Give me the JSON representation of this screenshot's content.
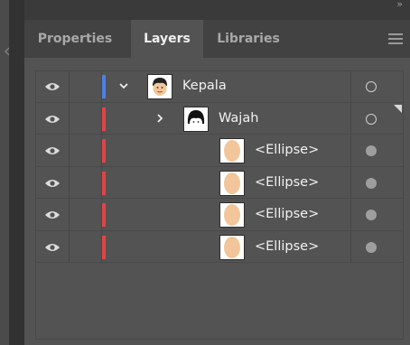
{
  "tabs": [
    {
      "label": "Properties",
      "active": false
    },
    {
      "label": "Layers",
      "active": true
    },
    {
      "label": "Libraries",
      "active": false
    }
  ],
  "top_bar": {
    "collapse_glyph": "»"
  },
  "colors": {
    "parent_layer": "#4f7fe5",
    "sublayer": "#e04545",
    "panel_bg": "#535353",
    "tab_bar_bg": "#424242"
  },
  "layers": [
    {
      "name": "Kepala",
      "expanded": true,
      "thumb": "face-icon"
    },
    {
      "name": "Wajah",
      "expanded": false,
      "thumb": "face-hair-icon"
    },
    {
      "name": "<Ellipse>",
      "thumb": "ellipse-icon"
    },
    {
      "name": "<Ellipse>",
      "thumb": "ellipse-icon"
    },
    {
      "name": "<Ellipse>",
      "thumb": "ellipse-icon"
    },
    {
      "name": "<Ellipse>",
      "thumb": "ellipse-icon"
    }
  ]
}
